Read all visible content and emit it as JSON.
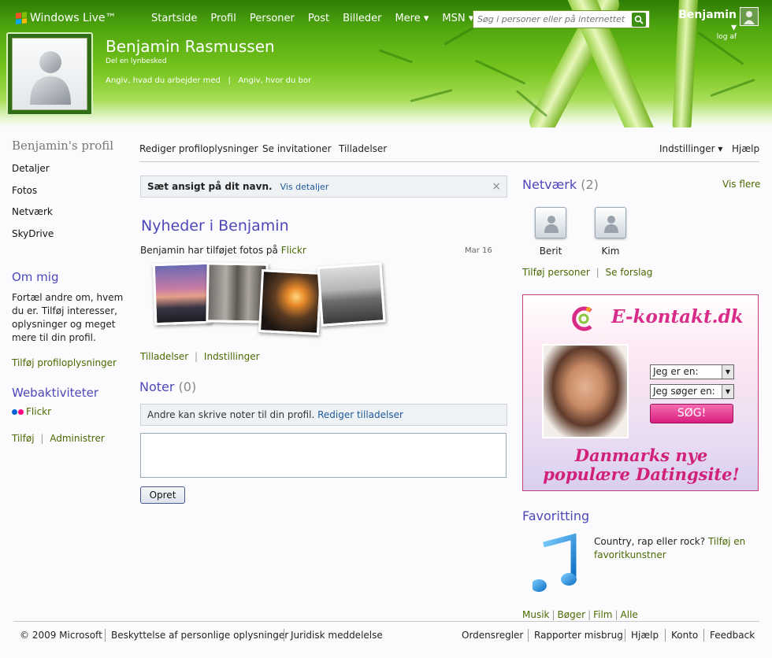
{
  "header": {
    "brand": "Windows Live™",
    "nav": [
      "Startside",
      "Profil",
      "Personer",
      "Post",
      "Billeder",
      "Mere ▾",
      "MSN ▾"
    ],
    "search_placeholder": "Søg i personer eller på internettet",
    "user_name": "Benjamin ▾",
    "signout": "log af",
    "profile_name": "Benjamin Rasmussen",
    "quick_message": "Del en lynbesked",
    "work_link": "Angiv, hvad du arbejder med",
    "location_link": "Angiv, hvor du bor",
    "separator": "|"
  },
  "sidebar": {
    "title": "Benjamin's profil",
    "items": [
      "Detaljer",
      "Fotos",
      "Netværk",
      "SkyDrive"
    ],
    "about_title": "Om mig",
    "about_text": "Fortæl andre om, hvem du er. Tilføj interesser, oplysninger og meget mere til din profil.",
    "add_profile_info": "Tilføj profiloplysninger",
    "web_title": "Webaktiviteter",
    "flickr": "Flickr",
    "add": "Tilføj",
    "administer": "Administrer",
    "separator": "|"
  },
  "toolbar": {
    "edit_profile": "Rediger profiloplysninger",
    "invitations": "Se invitationer",
    "permissions": "Tilladelser",
    "settings": "Indstillinger ▾",
    "help": "Hjælp"
  },
  "main": {
    "notice_bold": "Sæt ansigt på dit navn.",
    "notice_link": "Vis detaljer",
    "notice_close": "×",
    "news_title": "Nyheder i Benjamin",
    "news_text": "Benjamin har tilføjet fotos på ",
    "news_link": "Flickr",
    "news_date": "Mar 16",
    "link_permissions": "Tilladelser",
    "link_settings": "Indstillinger",
    "separator": "|",
    "notes_title": "Noter",
    "notes_count": "(0)",
    "notes_info": "Andre kan skrive noter til din profil.",
    "notes_info_link": "Rediger tilladelser",
    "create_button": "Opret"
  },
  "network": {
    "title": "Netværk",
    "count": "(2)",
    "see_more": "Vis flere",
    "contacts": [
      "Berit",
      "Kim"
    ],
    "add_people": "Tilføj personer",
    "suggestions": "Se forslag",
    "separator": "|"
  },
  "ad": {
    "logo": "E-kontakt.dk",
    "select1": "Jeg er en:",
    "select2": "Jeg søger en:",
    "button": "SØG!",
    "tagline1": "Danmarks nye",
    "tagline2": "populære Datingsite!"
  },
  "favorites": {
    "title": "Favoritting",
    "text": "Country, rap eller rock? ",
    "link": "Tilføj en favoritkunstner",
    "links": [
      "Musik",
      "Bøger",
      "Film",
      "Alle"
    ],
    "separator": "|"
  },
  "footer": {
    "left": [
      "© 2009 Microsoft",
      "Beskyttelse af personlige oplysninger",
      "Juridisk meddelelse"
    ],
    "right": [
      "Ordensregler",
      "Rapporter misbrug",
      "Hjælp",
      "Konto",
      "Feedback"
    ]
  },
  "colors": {
    "header_green": "#4fa60e",
    "heading_purple": "#4d47b8",
    "link_olive": "#4a6a00",
    "ad_pink": "#d72c88"
  }
}
